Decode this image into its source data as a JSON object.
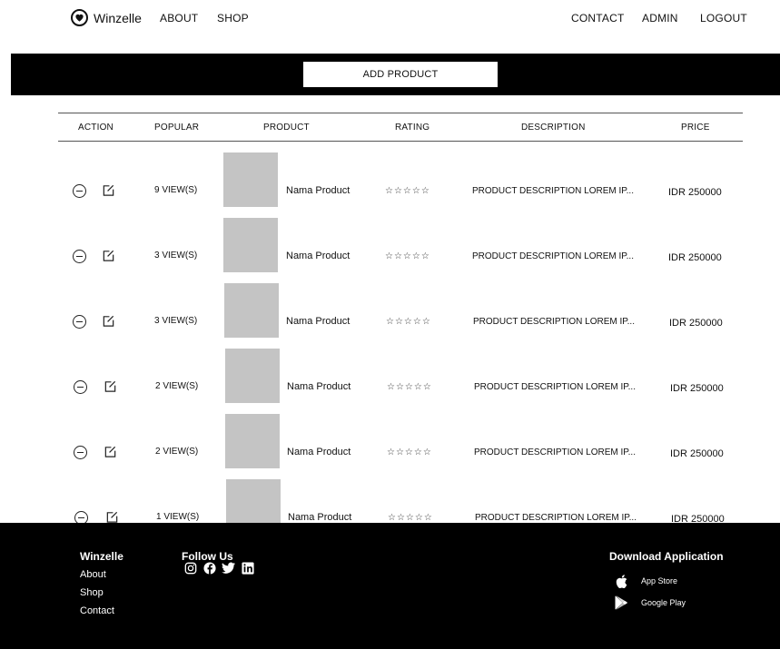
{
  "nav": {
    "brand": "Winzelle",
    "about": "ABOUT",
    "shop": "SHOP",
    "contact": "CONTACT",
    "admin": "ADMIN",
    "logout": "LOGOUT"
  },
  "toolbar": {
    "add_product_label": "ADD PRODUCT"
  },
  "table": {
    "headers": [
      "ACTION",
      "POPULAR",
      "PRODUCT",
      "RATING",
      "DESCRIPTION",
      "PRICE"
    ],
    "rows": [
      {
        "views": "9 VIEW(S)",
        "product": "Nama Product",
        "rating": "☆☆☆☆☆",
        "description": "PRODUCT DESCRIPTION LOREM IP...",
        "price": "IDR 250000"
      },
      {
        "views": "3 VIEW(S)",
        "product": "Nama Product",
        "rating": "☆☆☆☆☆",
        "description": "PRODUCT DESCRIPTION LOREM IP...",
        "price": "IDR 250000"
      },
      {
        "views": "3 VIEW(S)",
        "product": "Nama Product",
        "rating": "☆☆☆☆☆",
        "description": "PRODUCT DESCRIPTION LOREM IP...",
        "price": "IDR 250000"
      },
      {
        "views": "2 VIEW(S)",
        "product": "Nama Product",
        "rating": "☆☆☆☆☆",
        "description": "PRODUCT DESCRIPTION LOREM IP...",
        "price": "IDR 250000"
      },
      {
        "views": "2 VIEW(S)",
        "product": "Nama Product",
        "rating": "☆☆☆☆☆",
        "description": "PRODUCT DESCRIPTION LOREM IP...",
        "price": "IDR 250000"
      },
      {
        "views": "1 VIEW(S)",
        "product": "Nama Product",
        "rating": "☆☆☆☆☆",
        "description": "PRODUCT DESCRIPTION LOREM IP...",
        "price": "IDR 250000"
      }
    ]
  },
  "footer": {
    "brand": "Winzelle",
    "links": [
      "About",
      "Shop",
      "Contact"
    ],
    "follow_title": "Follow Us",
    "social_icons": [
      "instagram-icon",
      "facebook-icon",
      "twitter-icon",
      "linkedin-icon"
    ],
    "download_title": "Download Application",
    "app_store": "App Store",
    "google_play": "Google Play"
  },
  "colors": {
    "band": "#000000",
    "footer": "#000000",
    "thumbnail": "#c4c4c4"
  }
}
